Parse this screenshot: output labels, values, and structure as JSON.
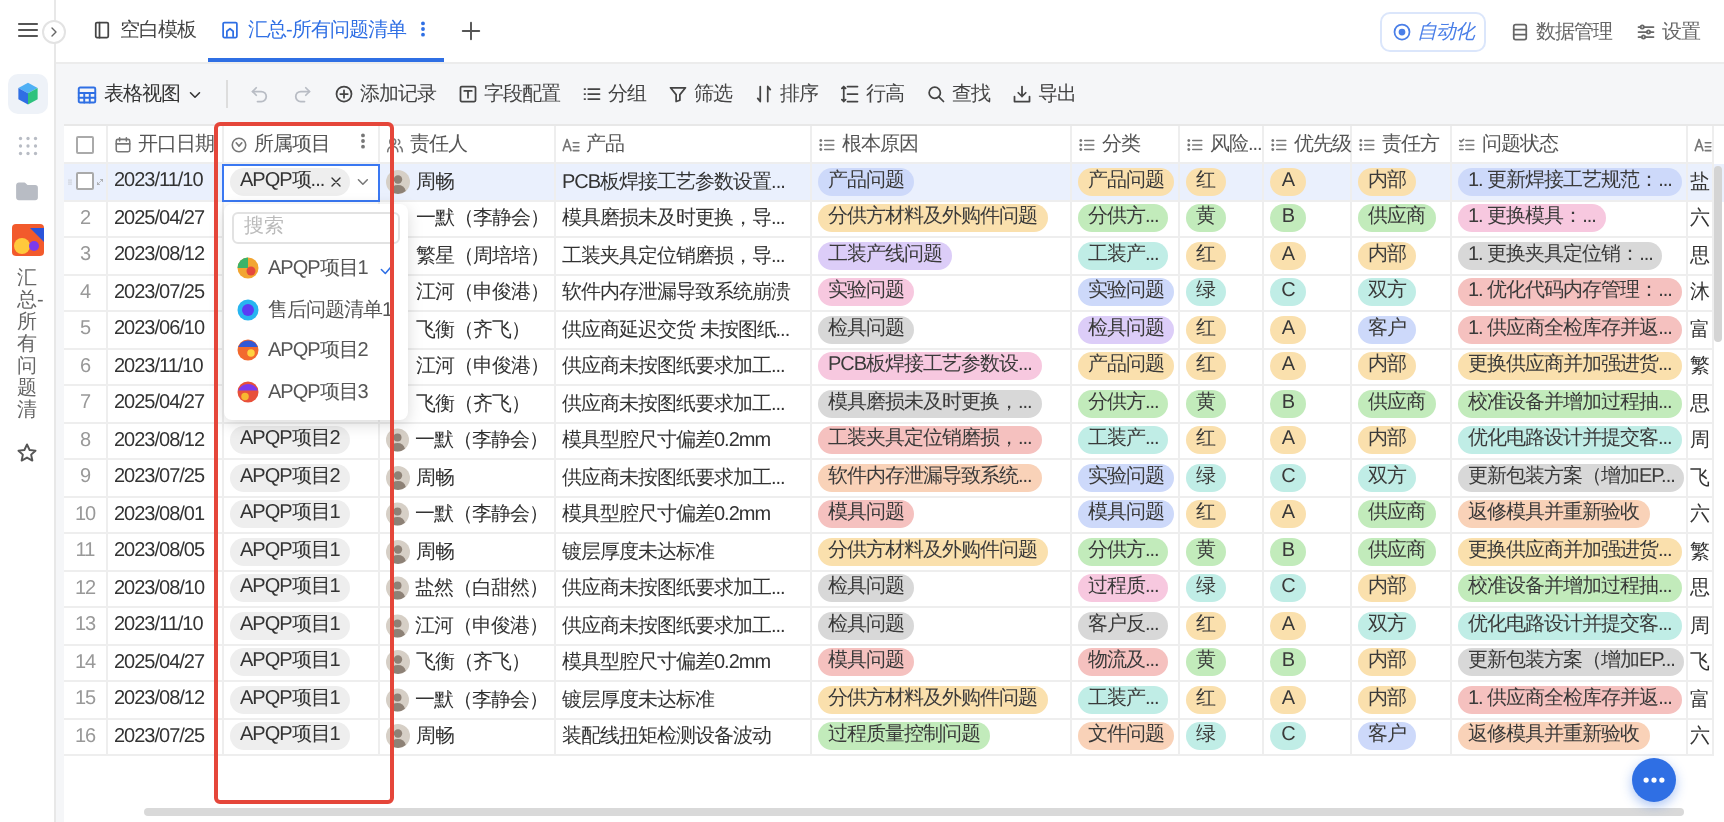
{
  "topbar": {
    "tabs": [
      {
        "label": "空白模板",
        "selected": false
      },
      {
        "label": "汇总-所有问题清单",
        "selected": true
      }
    ],
    "actions": [
      "自动化",
      "数据管理",
      "设置"
    ]
  },
  "rail": {
    "page_title": "汇总-所有问题清"
  },
  "toolbar": {
    "view": "表格视图",
    "tools": [
      "添加记录",
      "字段配置",
      "分组",
      "筛选",
      "排序",
      "行高",
      "查找",
      "导出"
    ]
  },
  "table": {
    "columns": [
      "开口日期",
      "所属项目",
      "责任人",
      "产品",
      "根本原因",
      "分类",
      "风险...",
      "优先级",
      "责任方",
      "问题状态"
    ],
    "all_selected": false,
    "rows": [
      {
        "selected": true,
        "date": "2023/11/10",
        "project_select": {
          "tag": "APQP项...",
          "search": {
            "placeholder": "搜索"
          },
          "options": [
            {
              "label": "APQP项目1",
              "selected": true
            },
            {
              "label": "售后问题清单1",
              "selected": false
            },
            {
              "label": "APQP项目2",
              "selected": false
            },
            {
              "label": "APQP项目3",
              "selected": false
            }
          ]
        },
        "avatar": true,
        "person": "周畅",
        "product": "PCB板焊接工艺参数设置...",
        "cause": {
          "text": "产品问题",
          "color": "#cdd9fa"
        },
        "category": {
          "text": "产品问题",
          "color": "#fae0ad"
        },
        "risk": {
          "text": "红",
          "color": "#fae0ad"
        },
        "priority": {
          "text": "A",
          "color": "#fae0ad"
        },
        "owner": {
          "text": "内部",
          "color": "#fae0ad"
        },
        "status": {
          "text": "1. 更新焊接工艺规范：...",
          "color": "#cdd9fa"
        },
        "column_12": "盐"
      },
      {
        "selected": false,
        "no": "2",
        "date": "2025/04/27",
        "avatar": false,
        "person": "一默（李静会）",
        "product": "模具磨损未及时更换，导...",
        "cause": {
          "text": "分供方材料及外购件问题",
          "color": "#fae0ad"
        },
        "category": {
          "text": "分供方...",
          "color": "#c2ebbb"
        },
        "risk": {
          "text": "黄",
          "color": "#c2ebbb"
        },
        "priority": {
          "text": "B",
          "color": "#c2ebbb"
        },
        "owner": {
          "text": "供应商",
          "color": "#c2ebbb"
        },
        "status": {
          "text": "1. 更换模具：...",
          "color": "#f7c8df"
        },
        "column_12": "六"
      },
      {
        "selected": false,
        "no": "3",
        "date": "2023/08/12",
        "avatar": false,
        "person": "繁星（周培培）",
        "product": "工装夹具定位销磨损，导...",
        "cause": {
          "text": "工装产线问题",
          "color": "#dccdf8"
        },
        "category": {
          "text": "工装产...",
          "color": "#c0ede6"
        },
        "risk": {
          "text": "红",
          "color": "#fae0ad"
        },
        "priority": {
          "text": "A",
          "color": "#fae0ad"
        },
        "owner": {
          "text": "内部",
          "color": "#fae0ad"
        },
        "status": {
          "text": "1. 更换夹具定位销：...",
          "color": "#d8d8d8"
        },
        "column_12": "思"
      },
      {
        "selected": false,
        "no": "4",
        "date": "2023/07/25",
        "avatar": false,
        "person": "江河（申俊港）",
        "product": "软件内存泄漏导致系统崩溃",
        "cause": {
          "text": "实验问题",
          "color": "#f7c8df"
        },
        "category": {
          "text": "实验问题",
          "color": "#cdd9fa"
        },
        "risk": {
          "text": "绿",
          "color": "#c0ede6"
        },
        "priority": {
          "text": "C",
          "color": "#c0ede6"
        },
        "owner": {
          "text": "双方",
          "color": "#c0ede6"
        },
        "status": {
          "text": "1. 优化代码内存管理：...",
          "color": "#f5c1bf"
        },
        "column_12": "沐"
      },
      {
        "selected": false,
        "no": "5",
        "date": "2023/06/10",
        "avatar": false,
        "person": "飞衡（齐飞）",
        "product": "供应商延迟交货 未按图纸...",
        "cause": {
          "text": "检具问题",
          "color": "#d8d8d8"
        },
        "category": {
          "text": "检具问题",
          "color": "#dccdf8"
        },
        "risk": {
          "text": "红",
          "color": "#fae0ad"
        },
        "priority": {
          "text": "A",
          "color": "#fae0ad"
        },
        "owner": {
          "text": "客户",
          "color": "#cdd9fa"
        },
        "status": {
          "text": "1. 供应商全检库存并返...",
          "color": "#f5c1bf"
        },
        "column_12": "富"
      },
      {
        "selected": false,
        "no": "6",
        "date": "2023/11/10",
        "avatar": false,
        "person": "江河（申俊港）",
        "product": "供应商未按图纸要求加工...",
        "cause": {
          "text": "PCB板焊接工艺参数设...",
          "color": "#f7c8df"
        },
        "category": {
          "text": "产品问题",
          "color": "#fae0ad"
        },
        "risk": {
          "text": "红",
          "color": "#fae0ad"
        },
        "priority": {
          "text": "A",
          "color": "#fae0ad"
        },
        "owner": {
          "text": "内部",
          "color": "#fae0ad"
        },
        "status": {
          "text": "更换供应商并加强进货...",
          "color": "#fae0ad"
        },
        "column_12": "繁"
      },
      {
        "selected": false,
        "no": "7",
        "date": "2025/04/27",
        "avatar": false,
        "person": "飞衡（齐飞）",
        "product": "供应商未按图纸要求加工...",
        "cause": {
          "text": "模具磨损未及时更换，...",
          "color": "#d8d8d8"
        },
        "category": {
          "text": "分供方...",
          "color": "#c2ebbb"
        },
        "risk": {
          "text": "黄",
          "color": "#c2ebbb"
        },
        "priority": {
          "text": "B",
          "color": "#c2ebbb"
        },
        "owner": {
          "text": "供应商",
          "color": "#c2ebbb"
        },
        "status": {
          "text": "校准设备并增加过程抽...",
          "color": "#c2ebbb"
        },
        "column_12": "思"
      },
      {
        "selected": false,
        "no": "8",
        "date": "2023/08/12",
        "project": "APQP项目2",
        "avatar": true,
        "person": "一默（李静会）",
        "product": "模具型腔尺寸偏差0.2mm",
        "cause": {
          "text": "工装夹具定位销磨损，...",
          "color": "#f5c1bf"
        },
        "category": {
          "text": "工装产...",
          "color": "#c0ede6"
        },
        "risk": {
          "text": "红",
          "color": "#fae0ad"
        },
        "priority": {
          "text": "A",
          "color": "#fae0ad"
        },
        "owner": {
          "text": "内部",
          "color": "#fae0ad"
        },
        "status": {
          "text": "优化电路设计并提交客...",
          "color": "#c0ede6"
        },
        "column_12": "周"
      },
      {
        "selected": false,
        "no": "9",
        "date": "2023/07/25",
        "project": "APQP项目2",
        "avatar": true,
        "person": "周畅",
        "product": "供应商未按图纸要求加工...",
        "cause": {
          "text": "软件内存泄漏导致系统...",
          "color": "#f9d2b8"
        },
        "category": {
          "text": "实验问题",
          "color": "#cdd9fa"
        },
        "risk": {
          "text": "绿",
          "color": "#c0ede6"
        },
        "priority": {
          "text": "C",
          "color": "#c0ede6"
        },
        "owner": {
          "text": "双方",
          "color": "#c0ede6"
        },
        "status": {
          "text": "更新包装方案（增加EP...",
          "color": "#d8d8d8"
        },
        "column_12": "飞"
      },
      {
        "selected": false,
        "no": "10",
        "date": "2023/08/01",
        "project": "APQP项目1",
        "avatar": true,
        "person": "一默（李静会）",
        "product": "模具型腔尺寸偏差0.2mm",
        "cause": {
          "text": "模具问题",
          "color": "#f5c1bf"
        },
        "category": {
          "text": "模具问题",
          "color": "#cdd9fa"
        },
        "risk": {
          "text": "红",
          "color": "#fae0ad"
        },
        "priority": {
          "text": "A",
          "color": "#fae0ad"
        },
        "owner": {
          "text": "供应商",
          "color": "#c2ebbb"
        },
        "status": {
          "text": "返修模具并重新验收",
          "color": "#f9d2b8"
        },
        "column_12": "六"
      },
      {
        "selected": false,
        "no": "11",
        "date": "2023/08/05",
        "project": "APQP项目1",
        "avatar": true,
        "person": "周畅",
        "product": "镀层厚度未达标准",
        "cause": {
          "text": "分供方材料及外购件问题",
          "color": "#fae0ad"
        },
        "category": {
          "text": "分供方...",
          "color": "#c2ebbb"
        },
        "risk": {
          "text": "黄",
          "color": "#c2ebbb"
        },
        "priority": {
          "text": "B",
          "color": "#c2ebbb"
        },
        "owner": {
          "text": "供应商",
          "color": "#c2ebbb"
        },
        "status": {
          "text": "更换供应商并加强进货...",
          "color": "#fae0ad"
        },
        "column_12": "繁"
      },
      {
        "selected": false,
        "no": "12",
        "date": "2023/08/10",
        "project": "APQP项目1",
        "avatar": true,
        "person": "盐然（白甜然）",
        "product": "供应商未按图纸要求加工...",
        "cause": {
          "text": "检具问题",
          "color": "#d8d8d8"
        },
        "category": {
          "text": "过程质...",
          "color": "#f7c8df"
        },
        "risk": {
          "text": "绿",
          "color": "#c0ede6"
        },
        "priority": {
          "text": "C",
          "color": "#c0ede6"
        },
        "owner": {
          "text": "内部",
          "color": "#fae0ad"
        },
        "status": {
          "text": "校准设备并增加过程抽...",
          "color": "#c2ebbb"
        },
        "column_12": "思"
      },
      {
        "selected": false,
        "no": "13",
        "date": "2023/11/10",
        "project": "APQP项目1",
        "avatar": true,
        "person": "江河（申俊港）",
        "product": "供应商未按图纸要求加工...",
        "cause": {
          "text": "检具问题",
          "color": "#d8d8d8"
        },
        "category": {
          "text": "客户反...",
          "color": "#d8d8d8"
        },
        "risk": {
          "text": "红",
          "color": "#fae0ad"
        },
        "priority": {
          "text": "A",
          "color": "#fae0ad"
        },
        "owner": {
          "text": "双方",
          "color": "#c0ede6"
        },
        "status": {
          "text": "优化电路设计并提交客...",
          "color": "#c0ede6"
        },
        "column_12": "周"
      },
      {
        "selected": false,
        "no": "14",
        "date": "2025/04/27",
        "project": "APQP项目1",
        "avatar": true,
        "person": "飞衡（齐飞）",
        "product": "模具型腔尺寸偏差0.2mm",
        "cause": {
          "text": "模具问题",
          "color": "#f5c1bf"
        },
        "category": {
          "text": "物流及...",
          "color": "#f5c1bf"
        },
        "risk": {
          "text": "黄",
          "color": "#c2ebbb"
        },
        "priority": {
          "text": "B",
          "color": "#c2ebbb"
        },
        "owner": {
          "text": "内部",
          "color": "#fae0ad"
        },
        "status": {
          "text": "更新包装方案（增加EP...",
          "color": "#d8d8d8"
        },
        "column_12": "飞"
      },
      {
        "selected": false,
        "no": "15",
        "date": "2023/08/12",
        "project": "APQP项目1",
        "avatar": true,
        "person": "一默（李静会）",
        "product": "镀层厚度未达标准",
        "cause": {
          "text": "分供方材料及外购件问题",
          "color": "#fae0ad"
        },
        "category": {
          "text": "工装产...",
          "color": "#c0ede6"
        },
        "risk": {
          "text": "红",
          "color": "#fae0ad"
        },
        "priority": {
          "text": "A",
          "color": "#fae0ad"
        },
        "owner": {
          "text": "内部",
          "color": "#fae0ad"
        },
        "status": {
          "text": "1. 供应商全检库存并返...",
          "color": "#f5c1bf"
        },
        "column_12": "富"
      },
      {
        "selected": false,
        "no": "16",
        "date": "2023/07/25",
        "project": "APQP项目1",
        "avatar": true,
        "person": "周畅",
        "product": "装配线扭矩检测设备波动",
        "cause": {
          "text": "过程质量控制问题",
          "color": "#c2ebbb"
        },
        "category": {
          "text": "文件问题",
          "color": "#f9d2b8"
        },
        "risk": {
          "text": "绿",
          "color": "#c0ede6"
        },
        "priority": {
          "text": "C",
          "color": "#c0ede6"
        },
        "owner": {
          "text": "客户",
          "color": "#cdd9fa"
        },
        "status": {
          "text": "返修模具并重新验收",
          "color": "#f9d2b8"
        },
        "column_12": "六"
      }
    ]
  }
}
